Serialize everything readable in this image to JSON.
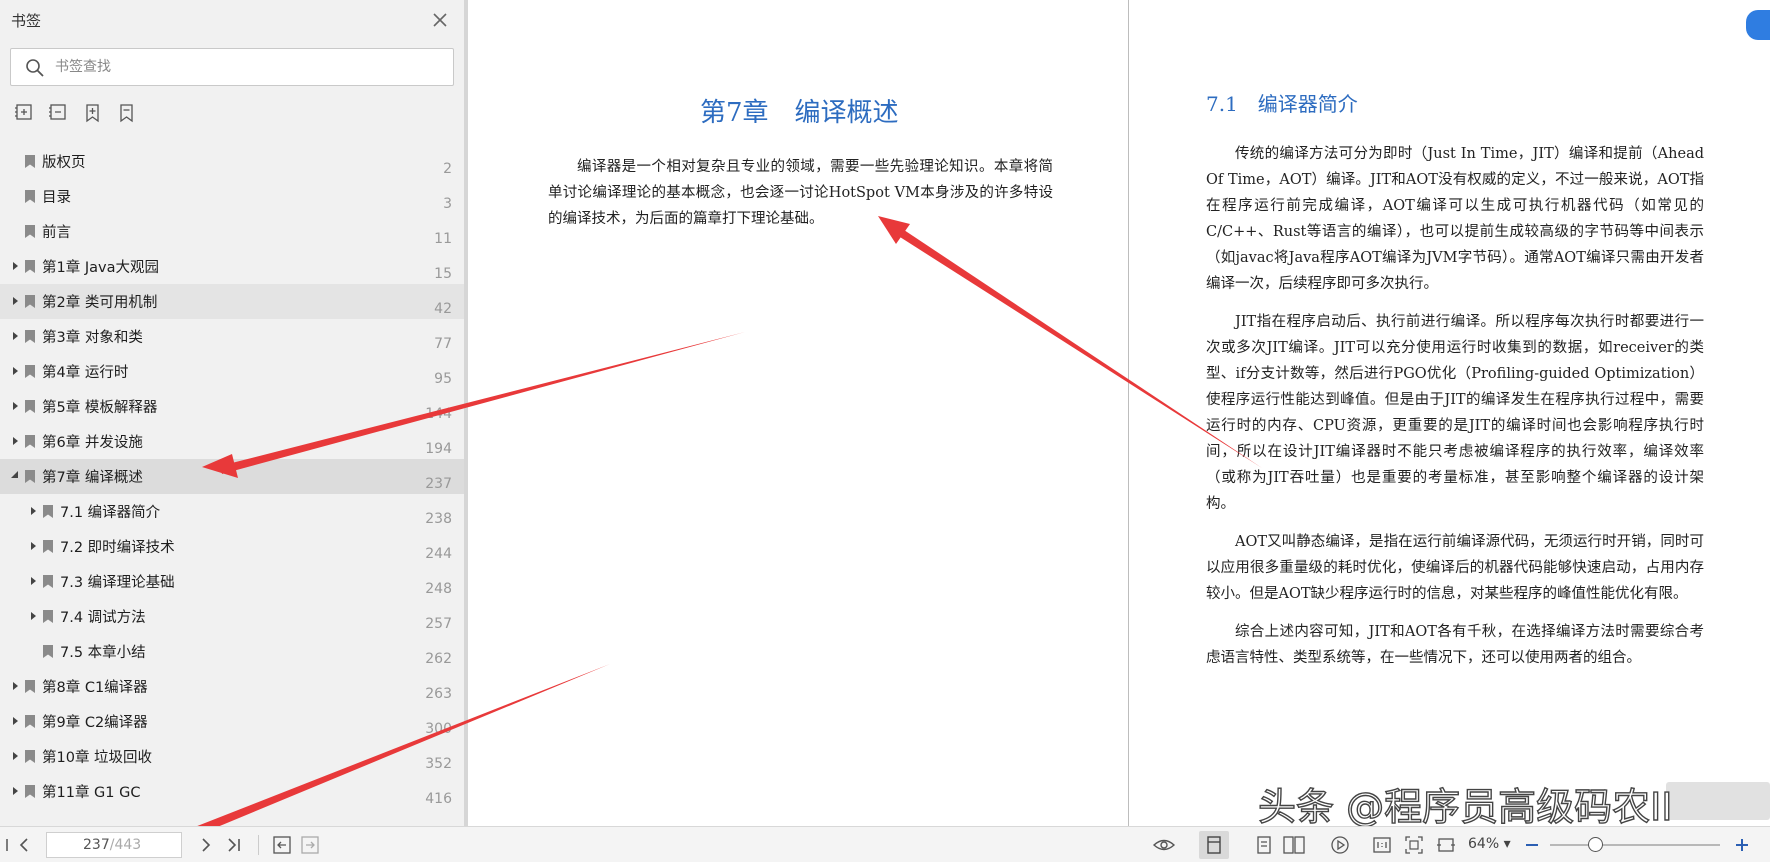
{
  "sidebar": {
    "title": "书签",
    "search_placeholder": "书签查找",
    "bookmarks": [
      {
        "label": "版权页",
        "page": "2",
        "level": 0,
        "expandable": false
      },
      {
        "label": "目录",
        "page": "3",
        "level": 0,
        "expandable": false
      },
      {
        "label": "前言",
        "page": "11",
        "level": 0,
        "expandable": false
      },
      {
        "label": "第1章 Java大观园",
        "page": "15",
        "level": 0,
        "expandable": true
      },
      {
        "label": "第2章 类可用机制",
        "page": "42",
        "level": 0,
        "expandable": true,
        "highlight": true
      },
      {
        "label": "第3章 对象和类",
        "page": "77",
        "level": 0,
        "expandable": true
      },
      {
        "label": "第4章 运行时",
        "page": "95",
        "level": 0,
        "expandable": true
      },
      {
        "label": "第5章 模板解释器",
        "page": "144",
        "level": 0,
        "expandable": true
      },
      {
        "label": "第6章 并发设施",
        "page": "194",
        "level": 0,
        "expandable": true
      },
      {
        "label": "第7章 编译概述",
        "page": "237",
        "level": 0,
        "expandable": true,
        "expanded": true,
        "selected": true
      },
      {
        "label": "7.1 编译器简介",
        "page": "238",
        "level": 1,
        "expandable": true
      },
      {
        "label": "7.2 即时编译技术",
        "page": "244",
        "level": 1,
        "expandable": true
      },
      {
        "label": "7.3 编译理论基础",
        "page": "248",
        "level": 1,
        "expandable": true
      },
      {
        "label": "7.4 调试方法",
        "page": "257",
        "level": 1,
        "expandable": true
      },
      {
        "label": "7.5 本章小结",
        "page": "262",
        "level": 1,
        "expandable": false
      },
      {
        "label": "第8章 C1编译器",
        "page": "263",
        "level": 0,
        "expandable": true
      },
      {
        "label": "第9章 C2编译器",
        "page": "300",
        "level": 0,
        "expandable": true
      },
      {
        "label": "第10章 垃圾回收",
        "page": "352",
        "level": 0,
        "expandable": true
      },
      {
        "label": "第11章 G1 GC",
        "page": "416",
        "level": 0,
        "expandable": true
      }
    ]
  },
  "document": {
    "left_page": {
      "chapter_title": "第7章　编译概述",
      "paragraph": "编译器是一个相对复杂且专业的领域，需要一些先验理论知识。本章将简单讨论编译理论的基本概念，也会逐一讨论HotSpot VM本身涉及的许多特设的编译技术，为后面的篇章打下理论基础。"
    },
    "right_page": {
      "section_title": "7.1　编译器简介",
      "paragraphs": [
        "传统的编译方法可分为即时（Just In Time，JIT）编译和提前（Ahead Of Time，AOT）编译。JIT和AOT没有权威的定义，不过一般来说，AOT指在程序运行前完成编译，AOT编译可以生成可执行机器代码（如常见的C/C++、Rust等语言的编译），也可以提前生成较高级的字节码等中间表示（如javac将Java程序AOT编译为JVM字节码）。通常AOT编译只需由开发者编译一次，后续程序即可多次执行。",
        "JIT指在程序启动后、执行前进行编译。所以程序每次执行时都要进行一次或多次JIT编译。JIT可以充分使用运行时收集到的数据，如receiver的类型、if分支计数等，然后进行PGO优化（Profiling-guided Optimization）使程序运行性能达到峰值。但是由于JIT的编译发生在程序执行过程中，需要运行时的内存、CPU资源，更重要的是JIT的编译时间也会影响程序执行时间，所以在设计JIT编译器时不能只考虑被编译程序的执行效率，编译效率（或称为JIT吞吐量）也是重要的考量标准，甚至影响整个编译器的设计架构。",
        "AOT又叫静态编译，是指在运行前编译源代码，无须运行时开销，同时可以应用很多重量级的耗时优化，使编译后的机器代码能够快速启动，占用内存较小。但是AOT缺少程序运行时的信息，对某些程序的峰值性能优化有限。",
        "综合上述内容可知，JIT和AOT各有千秋，在选择编译方法时需要综合考虑语言特性、类型系统等，在一些情况下，还可以使用两者的组合。"
      ]
    },
    "watermark": "头条 @程序员高级码农II",
    "annotation_color": "#e8393a"
  },
  "statusbar": {
    "current_page": "237",
    "total_pages": "/443",
    "zoom": "64%",
    "zoom_level_percent": 64
  }
}
